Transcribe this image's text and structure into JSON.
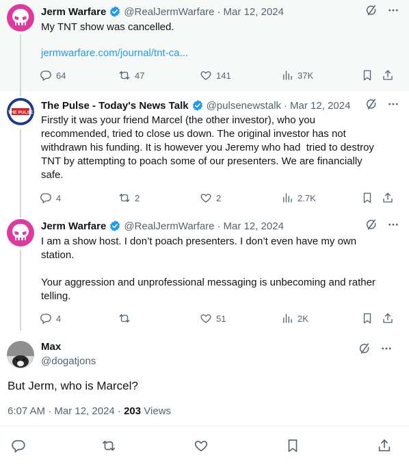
{
  "tweets": [
    {
      "name": "Jerm Warfare",
      "handle": "@RealJermWarfare",
      "date": "Mar 12, 2024",
      "text": "My TNT show was cancelled.",
      "link": "jermwarfare.com/journal/tnt-ca...",
      "replies": "64",
      "retweets": "47",
      "likes": "141",
      "views": "37K"
    },
    {
      "name": "The Pulse - Today's News Talk",
      "handle": "@pulsenewstalk",
      "date": "Mar 12, 2024",
      "avatar_text": "THE PULSE",
      "text": "Firstly it was your friend Marcel (the other investor), who you\nrecommended, tried to close us down. The original investor has not\nwithdrawn his funding. It is however you Jeremy who had  tried to destroy\nTNT by attempting to poach some of our presenters. We are financially\nsafe.",
      "replies": "4",
      "retweets": "2",
      "likes": "2",
      "views": "2.7K"
    },
    {
      "name": "Jerm Warfare",
      "handle": "@RealJermWarfare",
      "date": "Mar 12, 2024",
      "text": "I am a show host. I don’t poach presenters. I don’t even have my own\nstation.\n\nYour aggression and unprofessional messaging is unbecoming and rather\ntelling.",
      "replies": "4",
      "retweets": "",
      "likes": "51",
      "views": "2K"
    }
  ],
  "main_tweet": {
    "name": "Max",
    "handle": "@dogatjons",
    "text": "But Jerm, who is Marcel?",
    "time": "6:07 AM · Mar 12, 2024 · ",
    "views_count": "203",
    "views_label": " Views"
  },
  "separator": "·",
  "colors": {
    "accent": "#1d9bf0",
    "muted": "#536471",
    "jerm_avatar": "#e0389e"
  },
  "icons": [
    "verified-badge-icon",
    "grok-icon",
    "more-icon",
    "reply-icon",
    "retweet-icon",
    "like-icon",
    "views-icon",
    "bookmark-icon",
    "share-icon"
  ]
}
